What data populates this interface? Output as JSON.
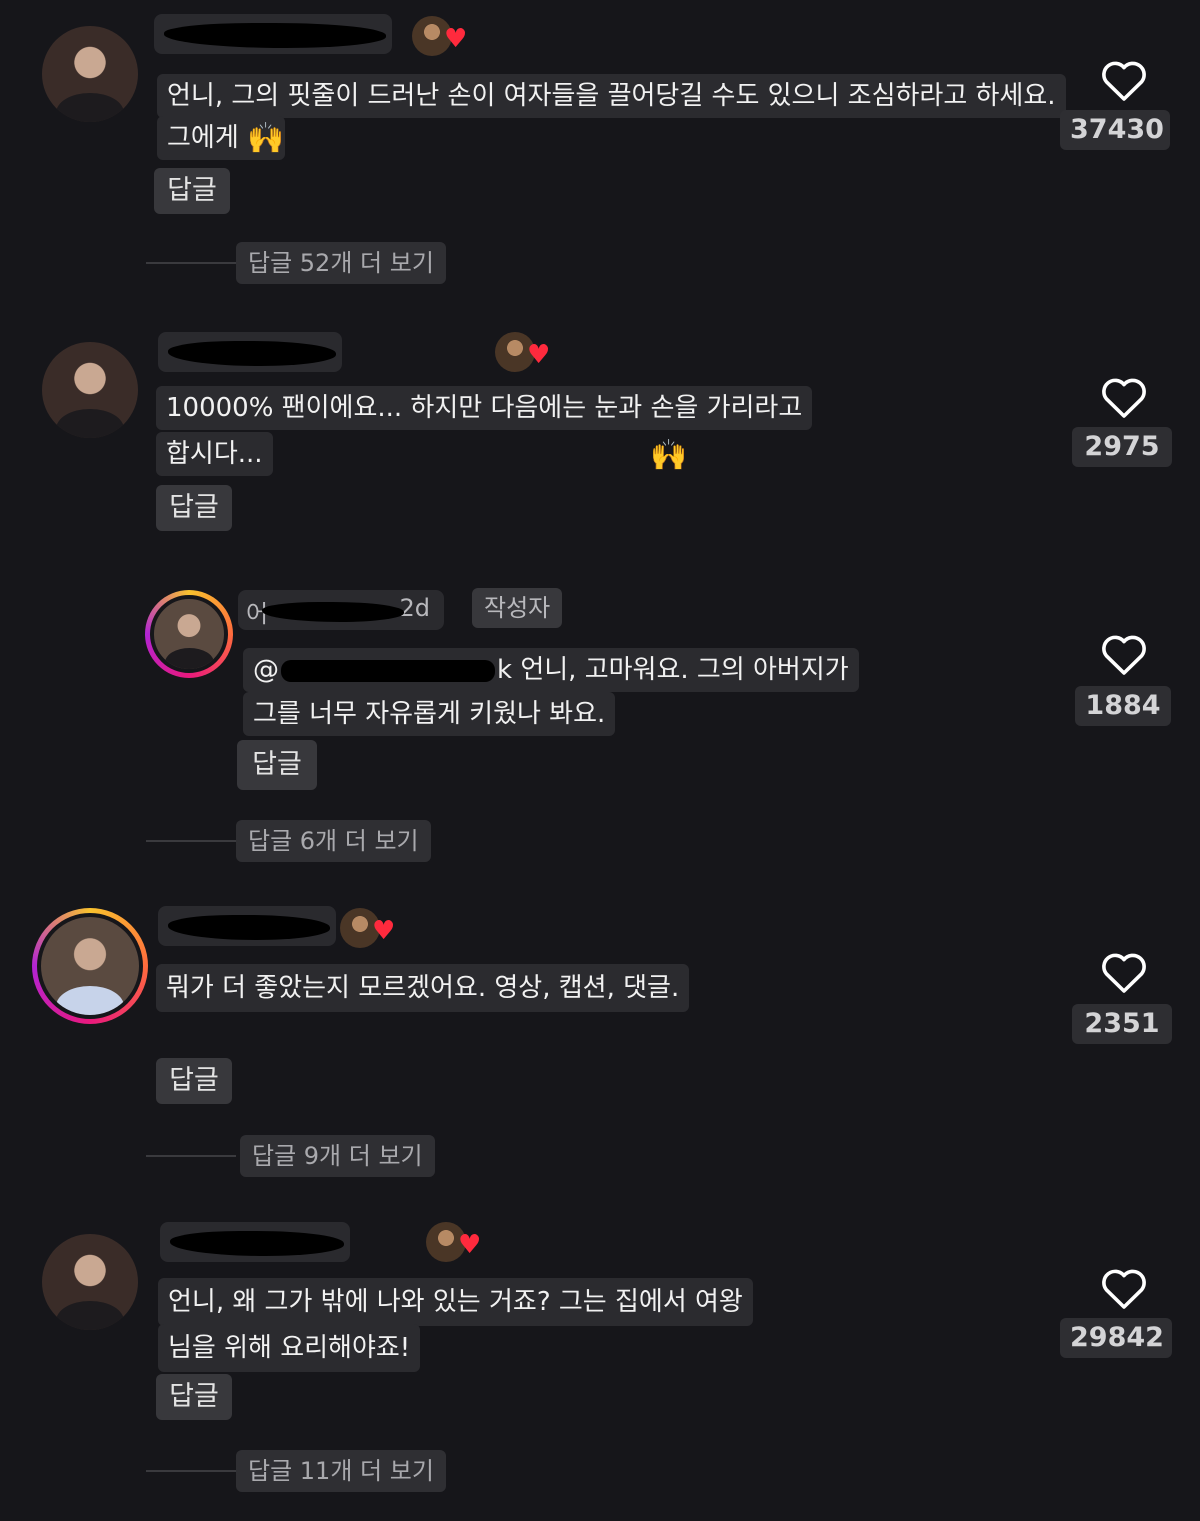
{
  "colors": {
    "background": "#16161a",
    "bubble": "#2b2b2f",
    "heart_badge": "#ff2a3d",
    "ring_gradient": [
      "#f9c22e",
      "#ff6b3d",
      "#e9197d",
      "#b224d4"
    ]
  },
  "comments": [
    {
      "lines": [
        "언니, 그의 핏줄이 드러난 손이 여자들을 끌어당길 수도 있으니 조심하라고 하세요.",
        "그에게"
      ],
      "emoji": "🙌",
      "reply_label": "답글",
      "more_replies": "답글 52개 더 보기",
      "likes": "37430",
      "username_redacted": true,
      "creator_liked": true
    },
    {
      "lines": [
        "10000% 팬이에요... 하지만 다음에는 눈과 손을 가리라고",
        "합시다..."
      ],
      "emoji": "🙌",
      "reply_label": "답글",
      "likes": "2975",
      "username_redacted": true,
      "creator_liked": true
    },
    {
      "is_reply": true,
      "username_prefix": "어",
      "username_suffix": "2d",
      "author_badge": "작성자",
      "mention_prefix": "@",
      "mention_suffix": "k",
      "lines": [
        "언니, 고마워요. 그의 아버지가",
        "그를 너무 자유롭게 키웠나 봐요."
      ],
      "reply_label": "답글",
      "more_replies": "답글 6개 더 보기",
      "likes": "1884"
    },
    {
      "lines": [
        "뭐가 더 좋았는지 모르겠어요. 영상, 캡션, 댓글."
      ],
      "reply_label": "답글",
      "more_replies": "답글 9개 더 보기",
      "likes": "2351",
      "username_redacted": true,
      "creator_liked": true
    },
    {
      "lines": [
        "언니, 왜 그가 밖에 나와 있는 거죠? 그는 집에서 여왕",
        "님을 위해 요리해야죠!"
      ],
      "reply_label": "답글",
      "more_replies": "답글 11개 더 보기",
      "likes": "29842",
      "username_redacted": true,
      "creator_liked": true
    }
  ]
}
